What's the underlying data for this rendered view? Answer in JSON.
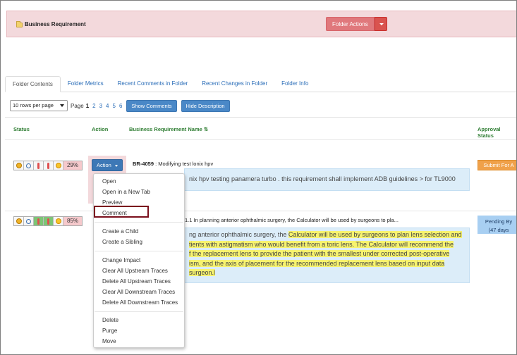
{
  "header": {
    "title": "Business Requirement",
    "folder_actions_label": "Folder Actions"
  },
  "tabs": [
    {
      "label": "Folder Contents"
    },
    {
      "label": "Folder Metrics"
    },
    {
      "label": "Recent Comments in Folder"
    },
    {
      "label": "Recent Changes in Folder"
    },
    {
      "label": "Folder Info"
    }
  ],
  "toolbar": {
    "rows_per_page": "10 rows per page",
    "page_label": "Page",
    "pages": [
      "1",
      "2",
      "3",
      "4",
      "5",
      "6"
    ],
    "show_comments": "Show Comments",
    "hide_description": "Hide Description"
  },
  "columns": {
    "status": "Status",
    "action": "Action",
    "name": "Business Requirement Name",
    "sort_glyph": "⇅",
    "approval": "Approval Status"
  },
  "rows": [
    {
      "percent": "29%",
      "action_label": "Action",
      "id": "BR-4059",
      "title": " : Modifying test lonix hpv",
      "desc_plain": "nix hpv testing panamera turbo . this  requirement shall implement ADB guidelines > for TL9000",
      "approval": "Submit For A"
    },
    {
      "percent": "85%",
      "title": "1.1 In planning anterior ophthalmic surgery, the Calculator will be used by surgeons to pla...",
      "desc_l1_plain": "ng anterior ophthalmic surgery, the ",
      "desc_l1_hl": "Calculator will be used by surgeons to plan lens selection and",
      "desc_l2_hl": "tients with astigmatism who would benefit from a toric lens. The Calculator will recommend the",
      "desc_l3_hl": "f the replacement lens to provide the patient with the smallest under corrected post-operative",
      "desc_l4_hl": "ism, and the axis of placement for the recommended replacement lens based on input data",
      "desc_l5_hl": "surgeon.l",
      "approval_l1": "Pending By",
      "approval_l2": "(47 days"
    }
  ],
  "menu": {
    "items": [
      "Open",
      "Open in a New Tab",
      "Preview",
      "Comment",
      "Create a Child",
      "Create a Sibling",
      "Change Impact",
      "Clear All Upstream Traces",
      "Delete All Upstream Traces",
      "Clear All Downstream Traces",
      "Delete All Downstream Traces",
      "Delete",
      "Purge",
      "Move"
    ]
  },
  "colors": {
    "header_bg": "#f3d9dc",
    "primary_button": "#3d78b6",
    "danger_button": "#d9534f",
    "column_header_green": "#2e7d32",
    "description_bg": "#dcedf9",
    "highlight_yellow": "#f7f36f",
    "annotation_box": "#7a0f1c"
  },
  "icons": {
    "folder": "folder-icon",
    "status": [
      "lock-icon",
      "search-icon",
      "thermometer-icon",
      "thermometer-icon",
      "sun-icon"
    ]
  }
}
